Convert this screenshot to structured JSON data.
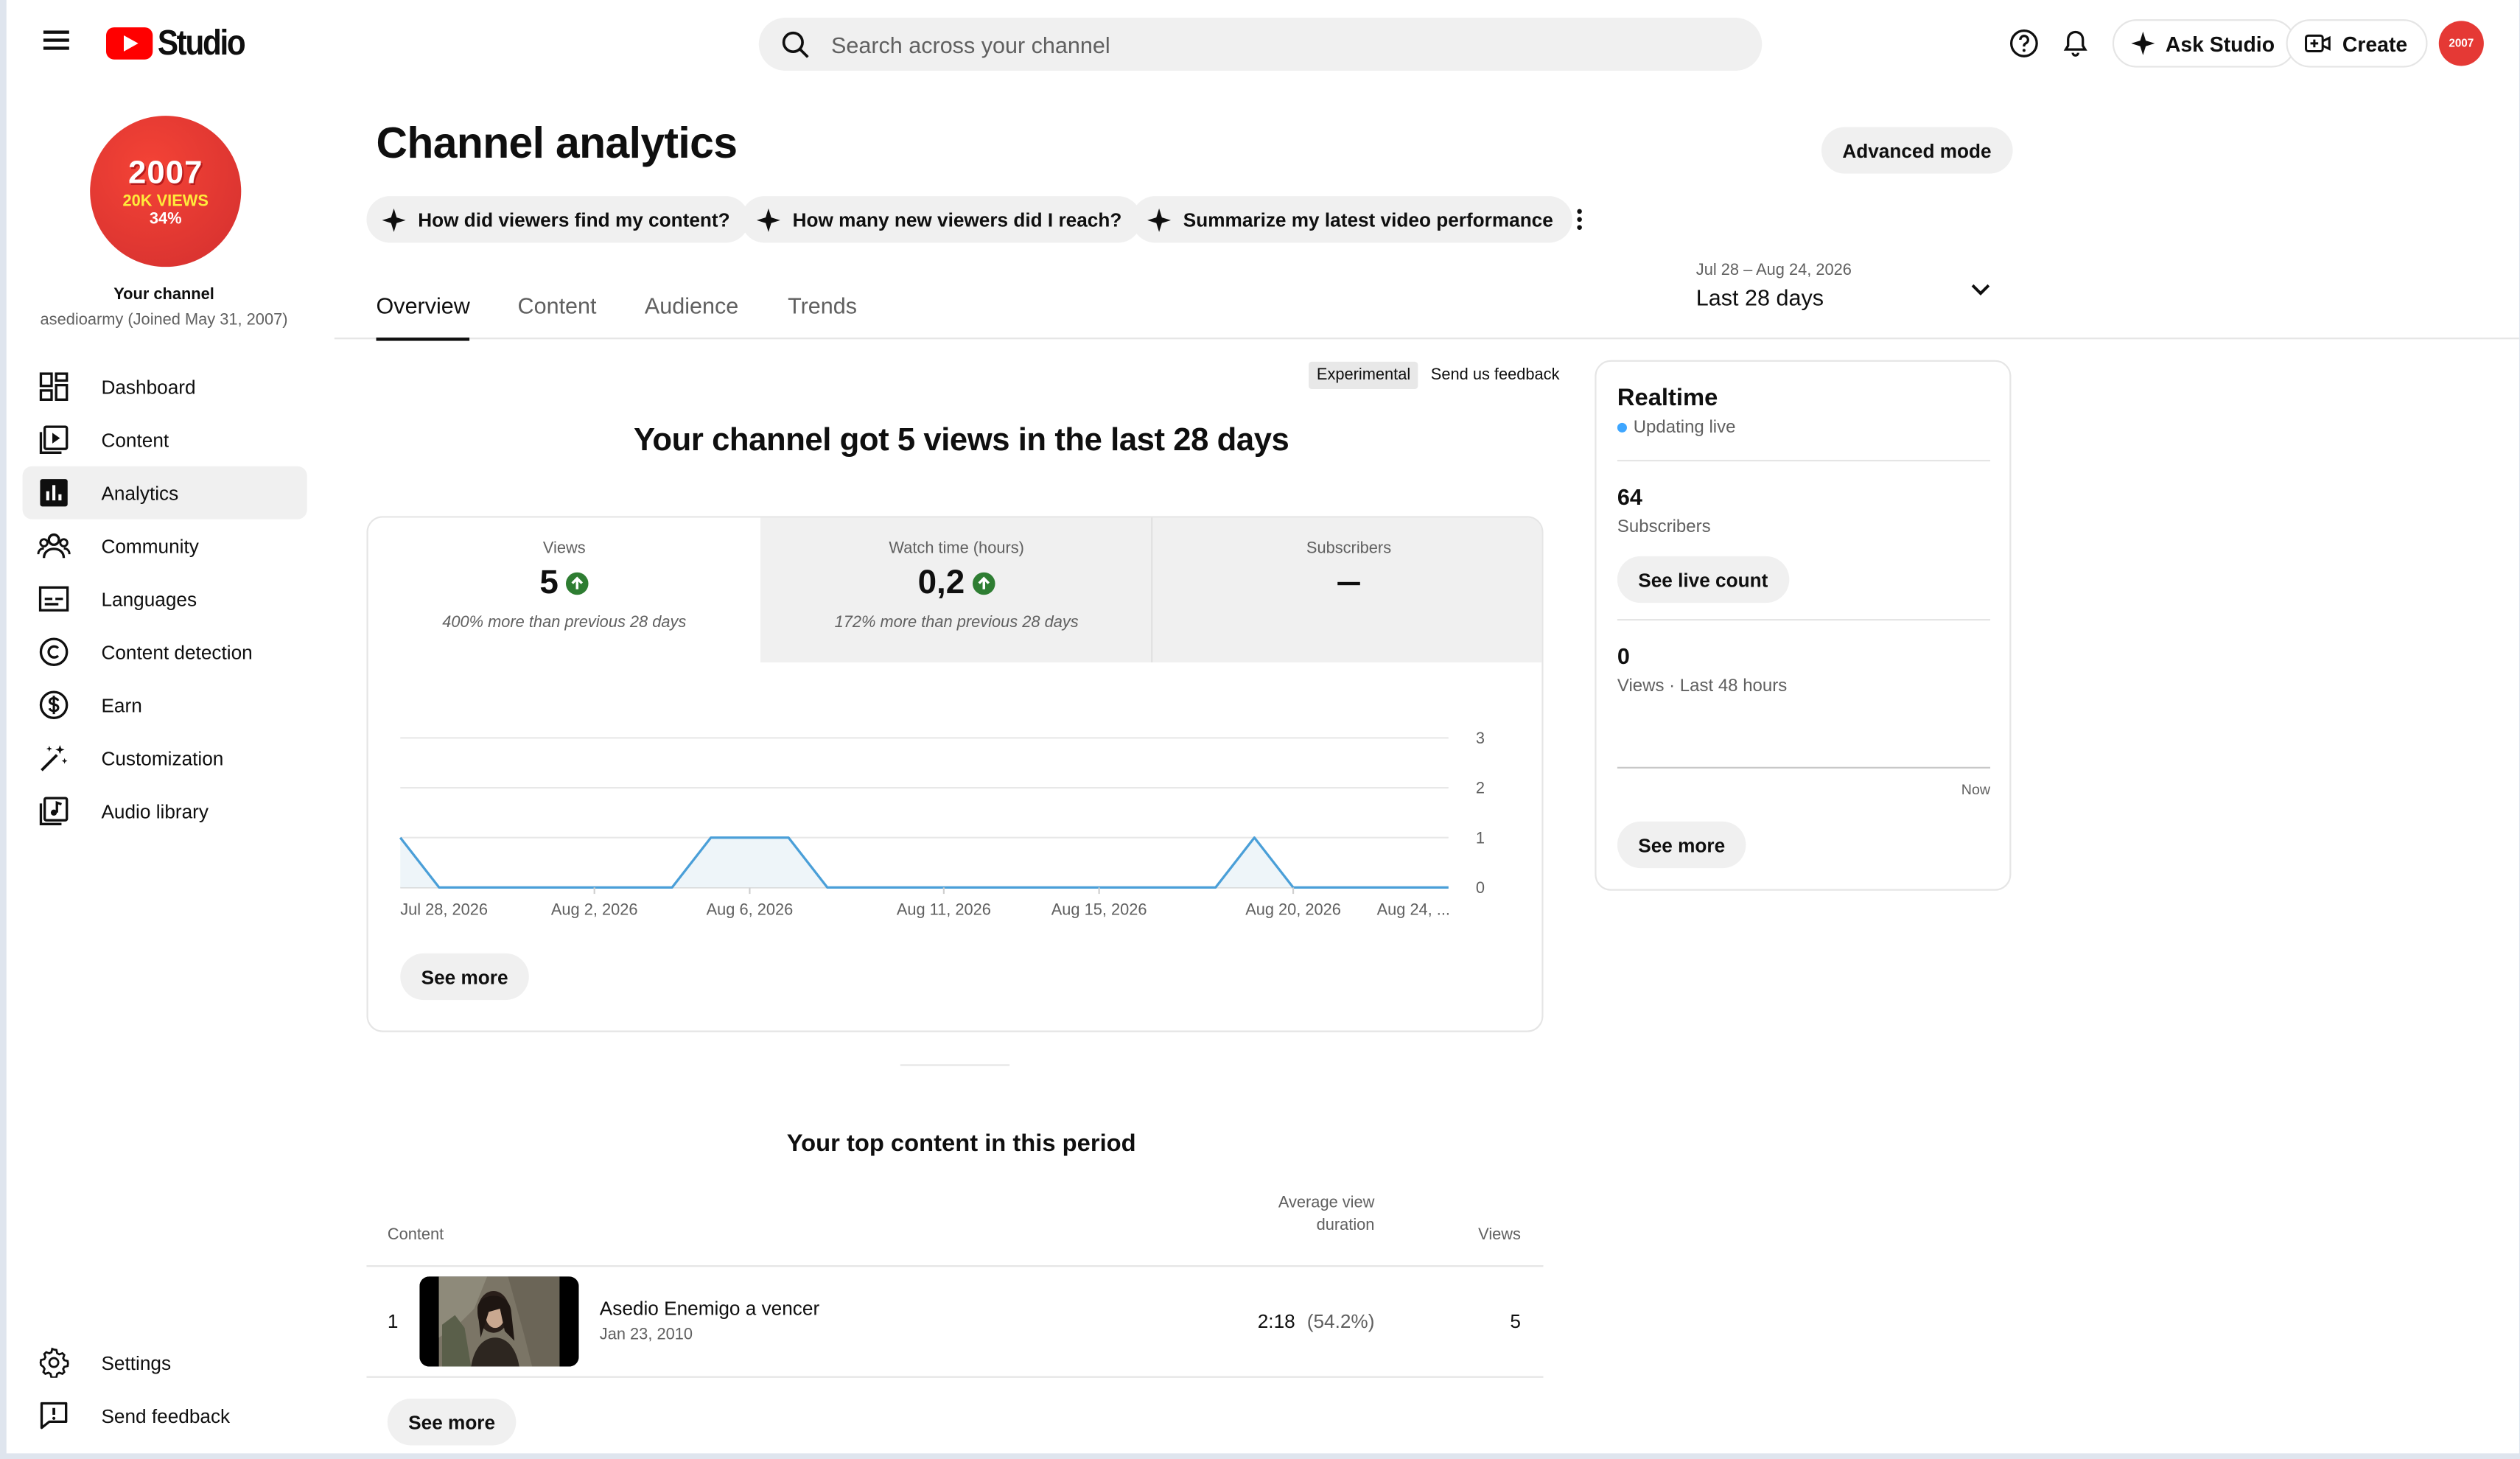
{
  "header": {
    "logo_text": "Studio",
    "search_placeholder": "Search across your channel",
    "ask_studio": "Ask Studio",
    "create": "Create",
    "avatar_text": "2007"
  },
  "sidebar": {
    "avatar": {
      "line1": "2007",
      "line2": "20K VIEWS",
      "line3": "34%"
    },
    "channel_label": "Your channel",
    "channel_sub": "asedioarmy (Joined May 31, 2007)",
    "items": [
      {
        "label": "Dashboard",
        "icon": "dashboard-icon"
      },
      {
        "label": "Content",
        "icon": "content-icon"
      },
      {
        "label": "Analytics",
        "icon": "analytics-icon",
        "active": true
      },
      {
        "label": "Community",
        "icon": "community-icon"
      },
      {
        "label": "Languages",
        "icon": "languages-icon"
      },
      {
        "label": "Content detection",
        "icon": "copyright-icon"
      },
      {
        "label": "Earn",
        "icon": "dollar-icon"
      },
      {
        "label": "Customization",
        "icon": "magic-wand-icon"
      },
      {
        "label": "Audio library",
        "icon": "audio-library-icon"
      }
    ],
    "bottom_items": [
      {
        "label": "Settings",
        "icon": "gear-icon"
      },
      {
        "label": "Send feedback",
        "icon": "feedback-icon"
      }
    ]
  },
  "main": {
    "title": "Channel analytics",
    "advanced_mode": "Advanced mode",
    "chips": [
      "How did viewers find my content?",
      "How many new viewers did I reach?",
      "Summarize my latest video performance"
    ],
    "tabs": [
      "Overview",
      "Content",
      "Audience",
      "Trends"
    ],
    "active_tab": "Overview",
    "date_range": {
      "range": "Jul 28 – Aug 24, 2026",
      "label": "Last 28 days"
    },
    "experimental": "Experimental",
    "send_feedback": "Send us feedback",
    "headline": "Your channel got 5 views in the last 28 days",
    "metrics": [
      {
        "label": "Views",
        "value": "5",
        "change": "400% more than previous 28 days"
      },
      {
        "label": "Watch time (hours)",
        "value": "0,2",
        "change": "172% more than previous 28 days"
      },
      {
        "label": "Subscribers",
        "value": ""
      }
    ],
    "see_more": "See more",
    "top_content": {
      "title": "Your top content in this period",
      "col_content": "Content",
      "col_avd_line1": "Average view",
      "col_avd_line2": "duration",
      "col_views": "Views",
      "rows": [
        {
          "rank": "1",
          "title": "Asedio Enemigo a vencer",
          "date": "Jan 23, 2010",
          "avd": "2:18",
          "avd_pct": "(54.2%)",
          "views": "5"
        }
      ],
      "see_more": "See more"
    }
  },
  "chart_data": {
    "type": "area",
    "x": [
      "Jul 28, 2026",
      "Jul 29",
      "Jul 30",
      "Jul 31",
      "Aug 1",
      "Aug 2, 2026",
      "Aug 3",
      "Aug 4",
      "Aug 5",
      "Aug 6, 2026",
      "Aug 7",
      "Aug 8",
      "Aug 9",
      "Aug 10",
      "Aug 11, 2026",
      "Aug 12",
      "Aug 13",
      "Aug 14",
      "Aug 15, 2026",
      "Aug 16",
      "Aug 17",
      "Aug 18",
      "Aug 19",
      "Aug 20, 2026",
      "Aug 21",
      "Aug 22",
      "Aug 23",
      "Aug 24, ..."
    ],
    "values": [
      1,
      0,
      0,
      0,
      0,
      0,
      0,
      0,
      1,
      1,
      1,
      0,
      0,
      0,
      0,
      0,
      0,
      0,
      0,
      0,
      0,
      0,
      1,
      0,
      0,
      0,
      0,
      0
    ],
    "tick_labels": [
      "Jul 28, 2026",
      "Aug 2, 2026",
      "Aug 6, 2026",
      "Aug 11, 2026",
      "Aug 15, 2026",
      "Aug 20, 2026",
      "Aug 24, ..."
    ],
    "tick_indices": [
      0,
      5,
      9,
      14,
      18,
      23,
      27
    ],
    "y_ticks": [
      0,
      1,
      2,
      3
    ],
    "ylim": [
      0,
      3
    ],
    "grid": true,
    "line_color": "#4a9fd8",
    "fill_color": "#eef5f9"
  },
  "realtime": {
    "title": "Realtime",
    "status": "Updating live",
    "subscribers_value": "64",
    "subscribers_label": "Subscribers",
    "see_live_count": "See live count",
    "views_value": "0",
    "views_label": "Views · Last 48 hours",
    "now_label": "Now",
    "see_more": "See more"
  },
  "colors": {
    "brand_red": "#ff0000",
    "up_green": "#2e7d32",
    "live_blue": "#3ea6ff"
  }
}
